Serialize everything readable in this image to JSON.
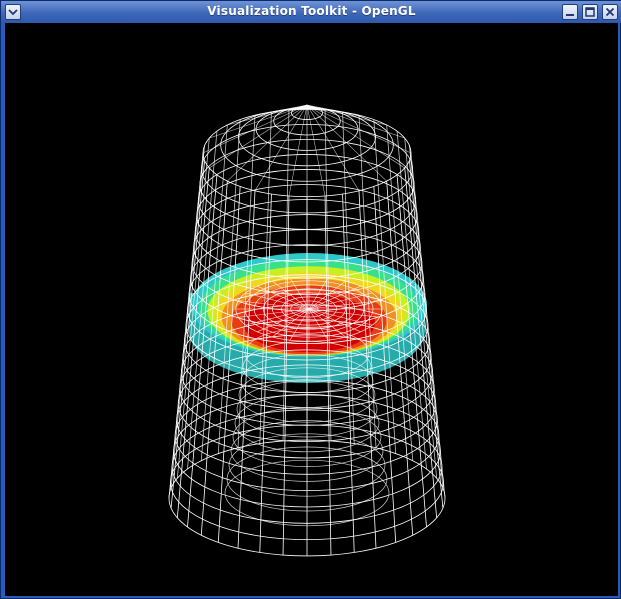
{
  "window": {
    "title": "Visualization Toolkit - OpenGL",
    "controls": {
      "menu_icon": "chevron-down-icon",
      "minimize_icon": "minimize-icon",
      "maximize_icon": "maximize-icon",
      "close_icon": "close-icon"
    }
  },
  "scene": {
    "background_color": "#000000",
    "wireframe_color": "#ffffff",
    "surface_colormap": [
      "#2ec8c8",
      "#39e08c",
      "#c8f020",
      "#f0d820",
      "#f09020",
      "#e83c14",
      "#d00000"
    ]
  }
}
